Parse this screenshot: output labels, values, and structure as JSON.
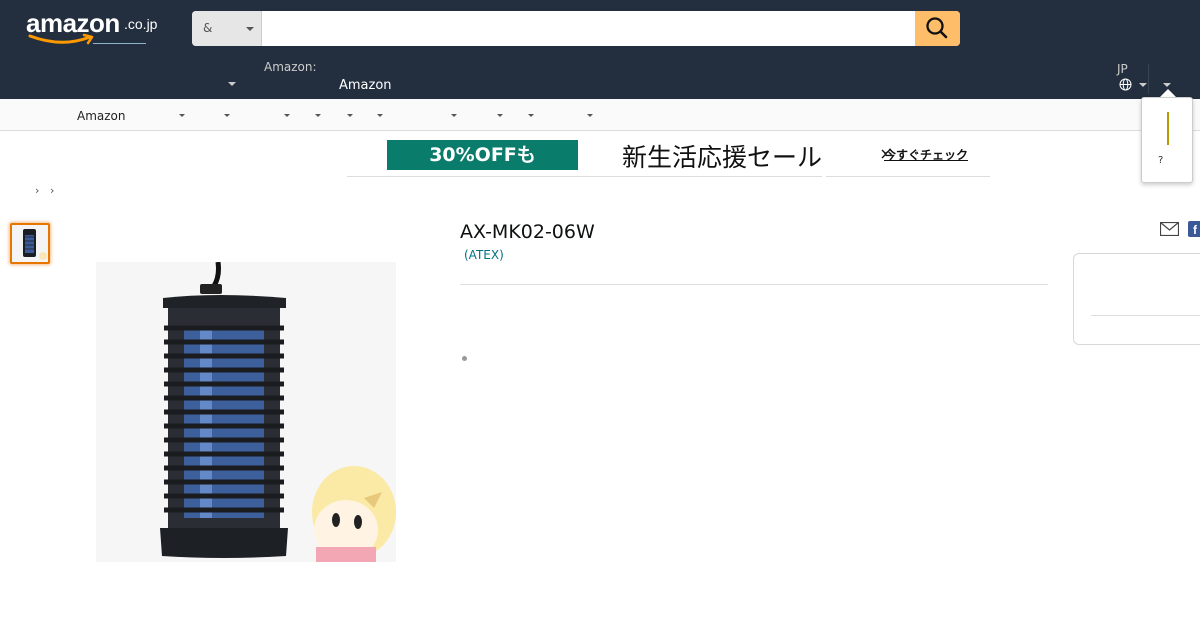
{
  "header": {
    "logo_text": "amazon",
    "logo_domain": ".co.jp",
    "search": {
      "category_label": "&",
      "placeholder": "",
      "value": ""
    }
  },
  "belt": {
    "deliver_line1": "Amazon:",
    "deliver_line2": "Amazon",
    "lang_code": "JP"
  },
  "subnav": {
    "first_item": "Amazon"
  },
  "popover": {
    "text": "?"
  },
  "banner": {
    "discount": "30%OFFも",
    "title": "新生活応援セール",
    "cta": "今すぐチェック"
  },
  "breadcrumb": {
    "separators": [
      "›",
      "›"
    ]
  },
  "product": {
    "title": "AX-MK02-06W",
    "brand": "(ATEX)"
  },
  "colors": {
    "header_bg": "#232f3e",
    "search_button": "#febd69",
    "banner_green": "#0a7c6b",
    "link": "#007185",
    "thumb_border": "#e77600"
  },
  "icons": {
    "search": "magnifier-icon",
    "globe": "globe-icon",
    "mail": "mail-icon",
    "facebook": "facebook-icon"
  }
}
